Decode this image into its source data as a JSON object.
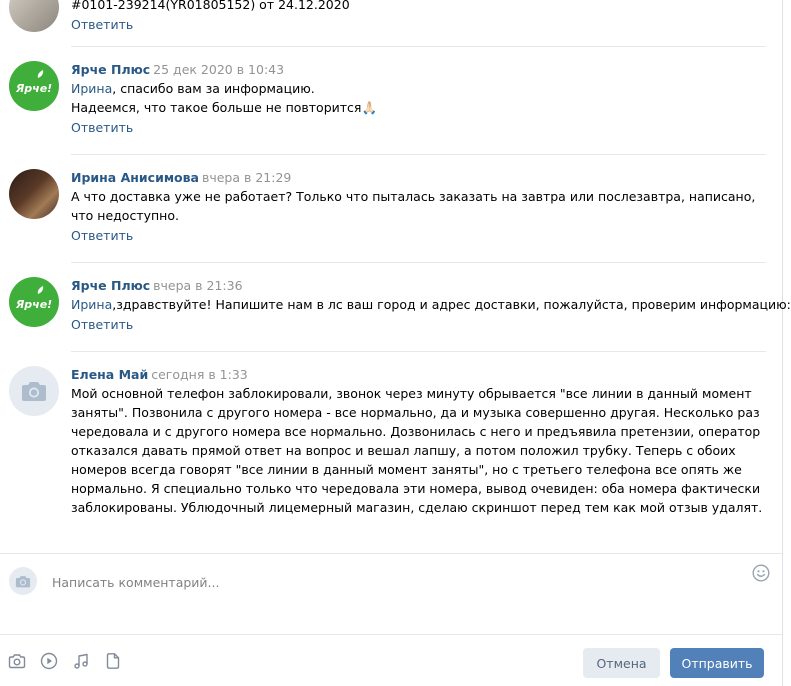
{
  "comments": [
    {
      "author": "",
      "date": "",
      "text_lines": [
        "#0101-239214(YR01805152) от 24.12.2020"
      ],
      "reply": "Ответить"
    },
    {
      "author": "Ярче Плюс",
      "date": "25 дек 2020 в 10:43",
      "mention": "Ирина",
      "line1_rest": ", спасибо вам за информацию.",
      "line2": "Надеемся, что такое больше не повторится🙏🏻",
      "reply": "Ответить",
      "avatar_logo": "Ярче!"
    },
    {
      "author": "Ирина Анисимова",
      "date": "вчера в 21:29",
      "text": "А что доставка уже не работает? Только что пыталась заказать на завтра или послезавтра, написано, что недоступно.",
      "reply": "Ответить"
    },
    {
      "author": "Ярче Плюс",
      "date": "вчера в 21:36",
      "mention": "Ирина",
      "line1_rest": ",здравствуйте! Напишите нам в лс ваш город и адрес доставки, пожалуйста, проверим информацию:)",
      "reply": "Ответить",
      "avatar_logo": "Ярче!"
    },
    {
      "author": "Елена Май",
      "date": "сегодня в 1:33",
      "text": "Мой основной телефон заблокировали, звонок через минуту обрывается \"все линии в данный момент заняты\". Позвонила с другого номера - все нормально, да и музыка совершенно другая. Несколько раз чередовала и с другого номера все нормально. Дозвонилась с него и предъявила претензии, оператор отказался давать прямой ответ на вопрос и вешал лапшу, а потом положил трубку. Теперь с обоих номеров всегда говорят \"все линии в данный момент заняты\", но с третьего телефона все опять же нормально. Я специально только что чередовала эти номера, вывод очевиден: оба номера фактически заблокированы. Ублюдочный лицемерный магазин, сделаю скриншот перед тем как мой отзыв удалят."
    }
  ],
  "composer": {
    "placeholder": "Написать комментарий...",
    "cancel_label": "Отмена",
    "send_label": "Отправить"
  },
  "icons": {
    "avatar_camera": "camera-icon",
    "composer_camera": "camera-icon",
    "smile": "smile-icon",
    "photo": "photo-attach-icon",
    "video": "video-attach-icon",
    "audio": "audio-attach-icon",
    "document": "document-attach-icon"
  },
  "colors": {
    "link": "#2a5885",
    "send_button": "#5181b8",
    "cancel_button": "#e5ebf1",
    "brand_green": "#3fae3a"
  }
}
